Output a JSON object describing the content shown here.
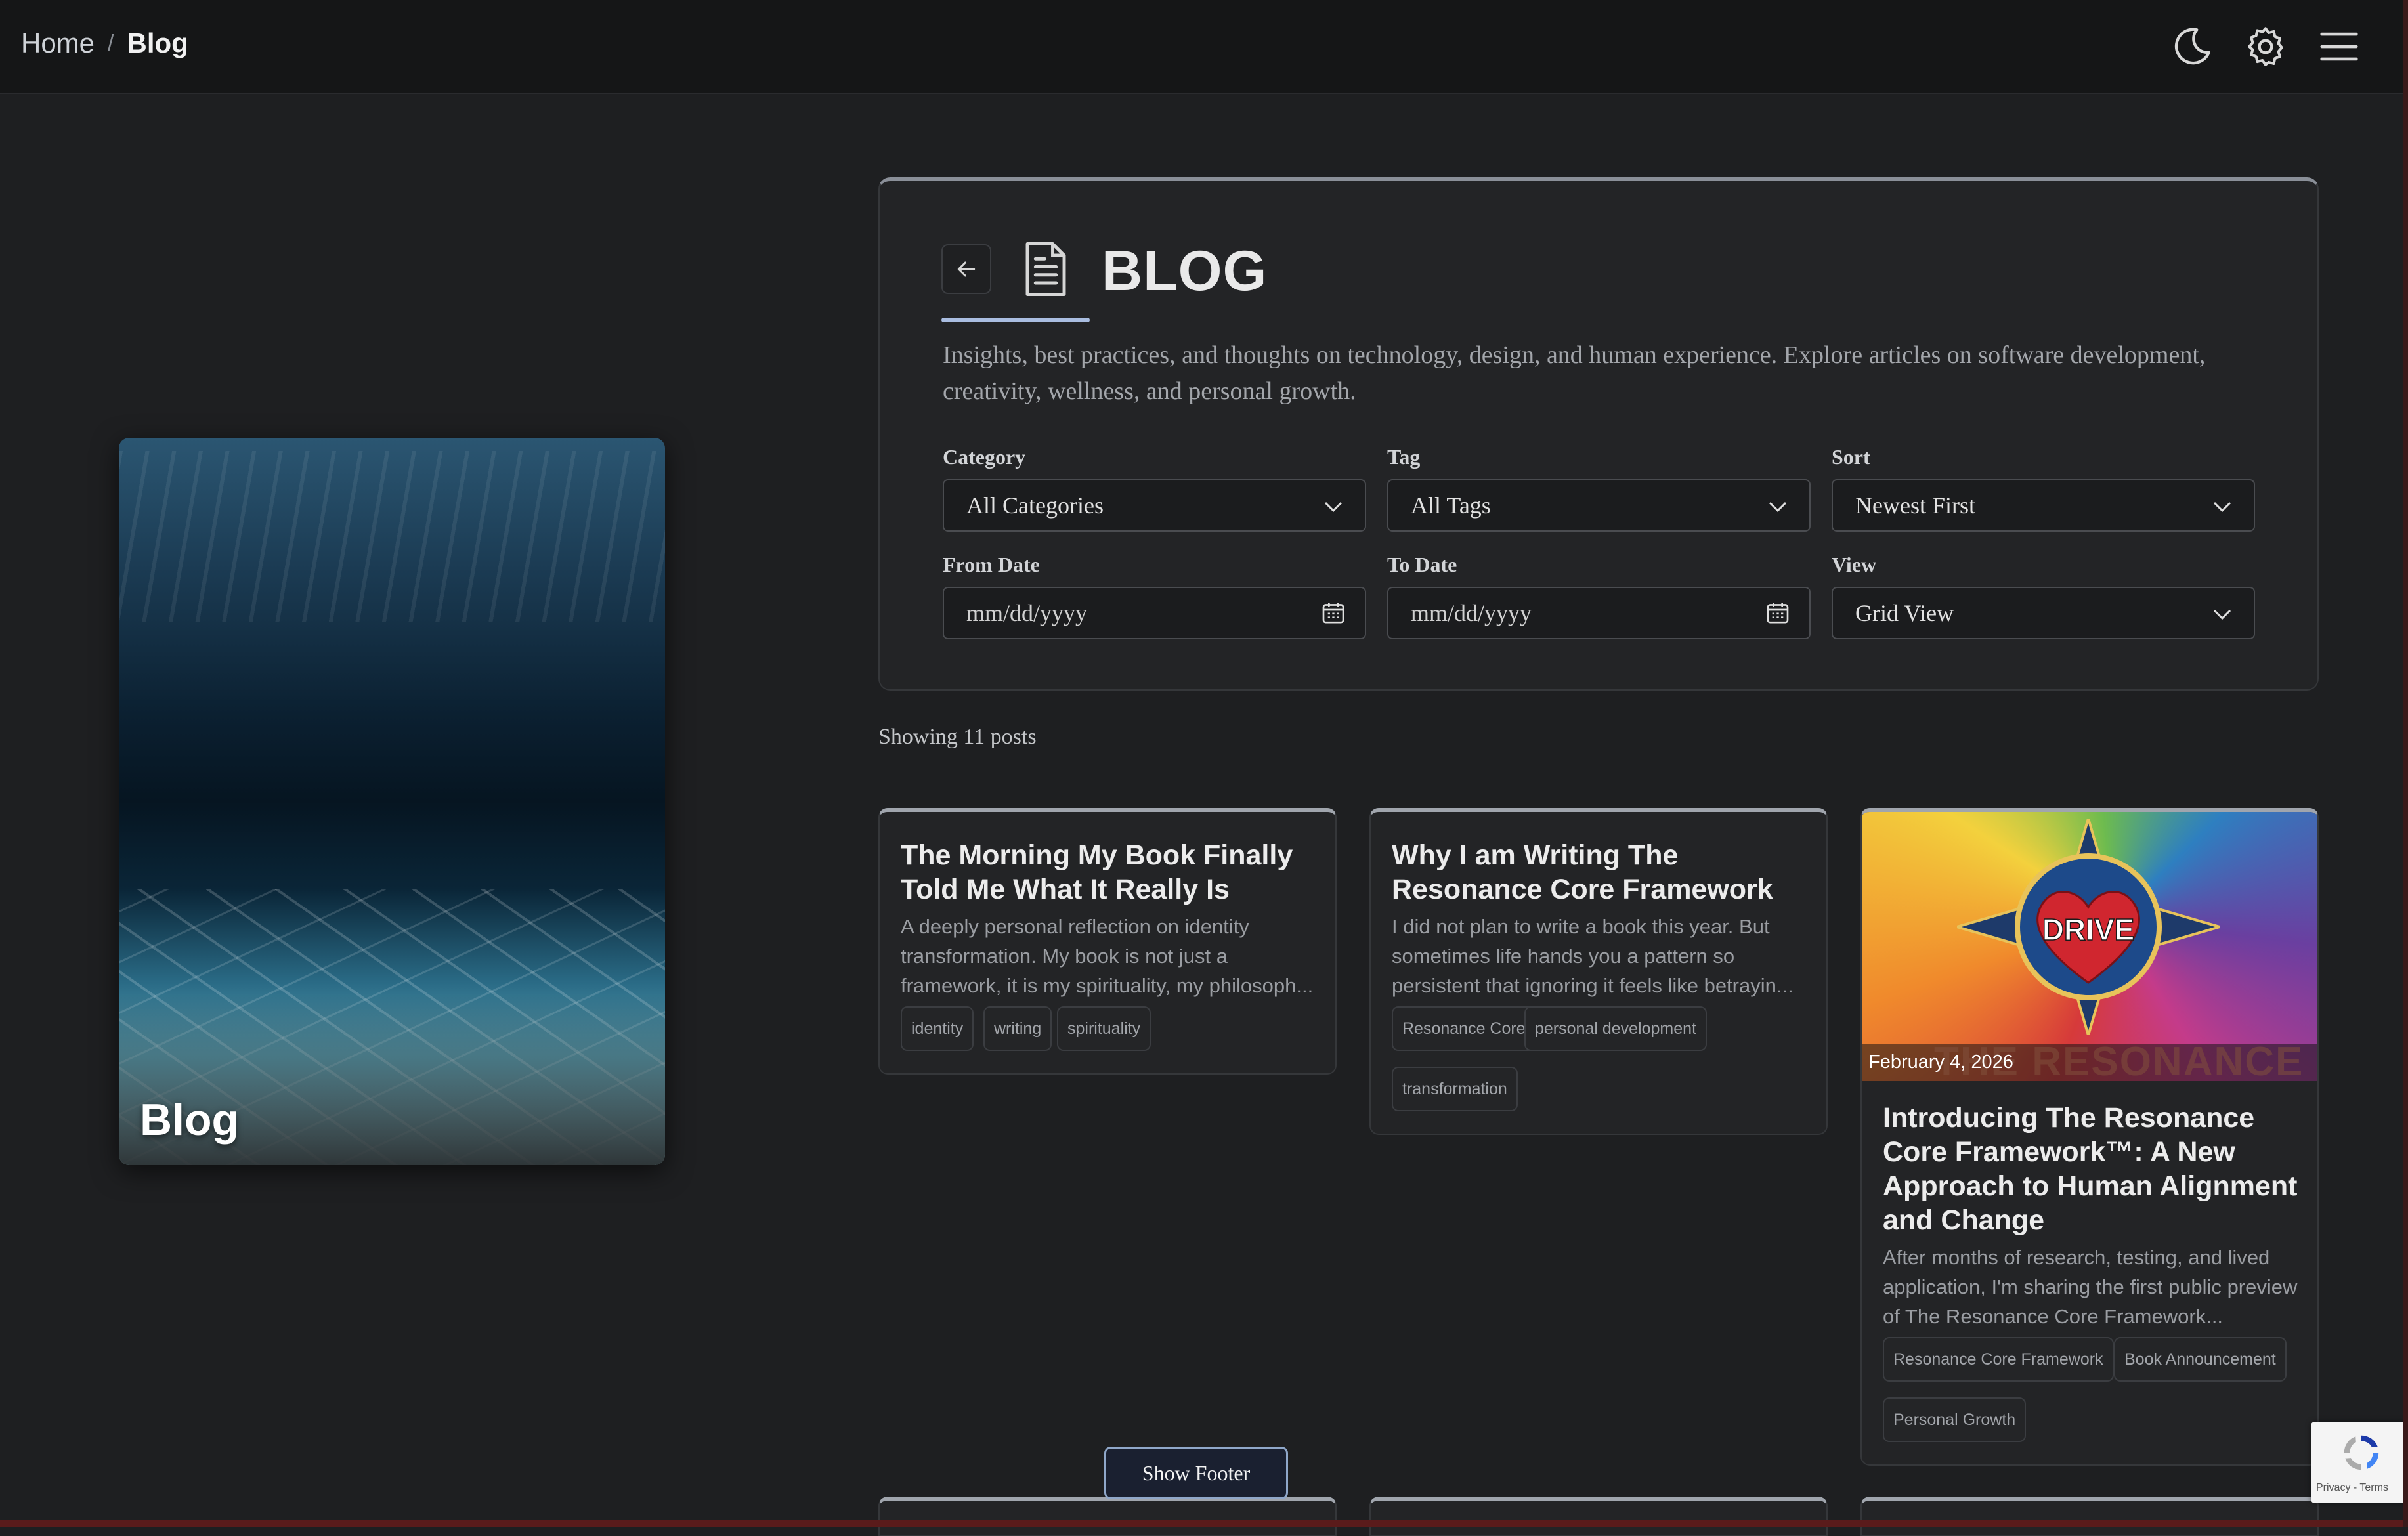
{
  "breadcrumb": {
    "home": "Home",
    "separator": "/",
    "current": "Blog"
  },
  "topbar": {
    "icons": [
      "moon-icon",
      "gear-icon",
      "hamburger-menu-icon"
    ]
  },
  "hero": {
    "title": "Blog"
  },
  "panel": {
    "title": "BLOG",
    "description": "Insights, best practices, and thoughts on technology, design, and human experience. Explore articles on software development, creativity, wellness, and personal growth.",
    "filters": {
      "category": {
        "label": "Category",
        "value": "All Categories"
      },
      "tag": {
        "label": "Tag",
        "value": "All Tags"
      },
      "sort": {
        "label": "Sort",
        "value": "Newest First"
      },
      "from_date": {
        "label": "From Date",
        "placeholder": "mm/dd/yyyy"
      },
      "to_date": {
        "label": "To Date",
        "placeholder": "mm/dd/yyyy"
      },
      "view": {
        "label": "View",
        "value": "Grid View"
      }
    }
  },
  "results": {
    "showing": "Showing 11 posts"
  },
  "posts": [
    {
      "title": "The Morning My Book Finally Told Me What It Really Is",
      "excerpt": "A deeply personal reflection on identity transformation. My book is not just a framework, it is my spirituality, my philosoph...",
      "tags": [
        "identity",
        "writing",
        "spirituality"
      ]
    },
    {
      "title": "Why I am Writing The Resonance Core Framework",
      "excerpt": "I did not plan to write a book this year. But sometimes life hands you a pattern so persistent that ignoring it feels like betrayin...",
      "tags": [
        "Resonance Core",
        "personal development",
        "transformation"
      ]
    },
    {
      "date": "February 4, 2026",
      "image_text": {
        "badge": "DRIVE",
        "banner": "THE RESONANCE"
      },
      "title": "Introducing The Resonance Core Framework™: A New Approach to Human Alignment and Change",
      "excerpt": "After months of research, testing, and lived application, I'm sharing the first public preview of The Resonance Core Framework...",
      "tags": [
        "Resonance Core Framework",
        "Book Announcement",
        "Personal Growth"
      ]
    }
  ],
  "footer_toggle": {
    "label": "Show Footer"
  },
  "recaptcha": {
    "text": "Privacy - Terms"
  },
  "colors": {
    "background": "#1e1f21",
    "topbar": "#151617",
    "panel": "#232426",
    "accent": "#a9bde0"
  }
}
